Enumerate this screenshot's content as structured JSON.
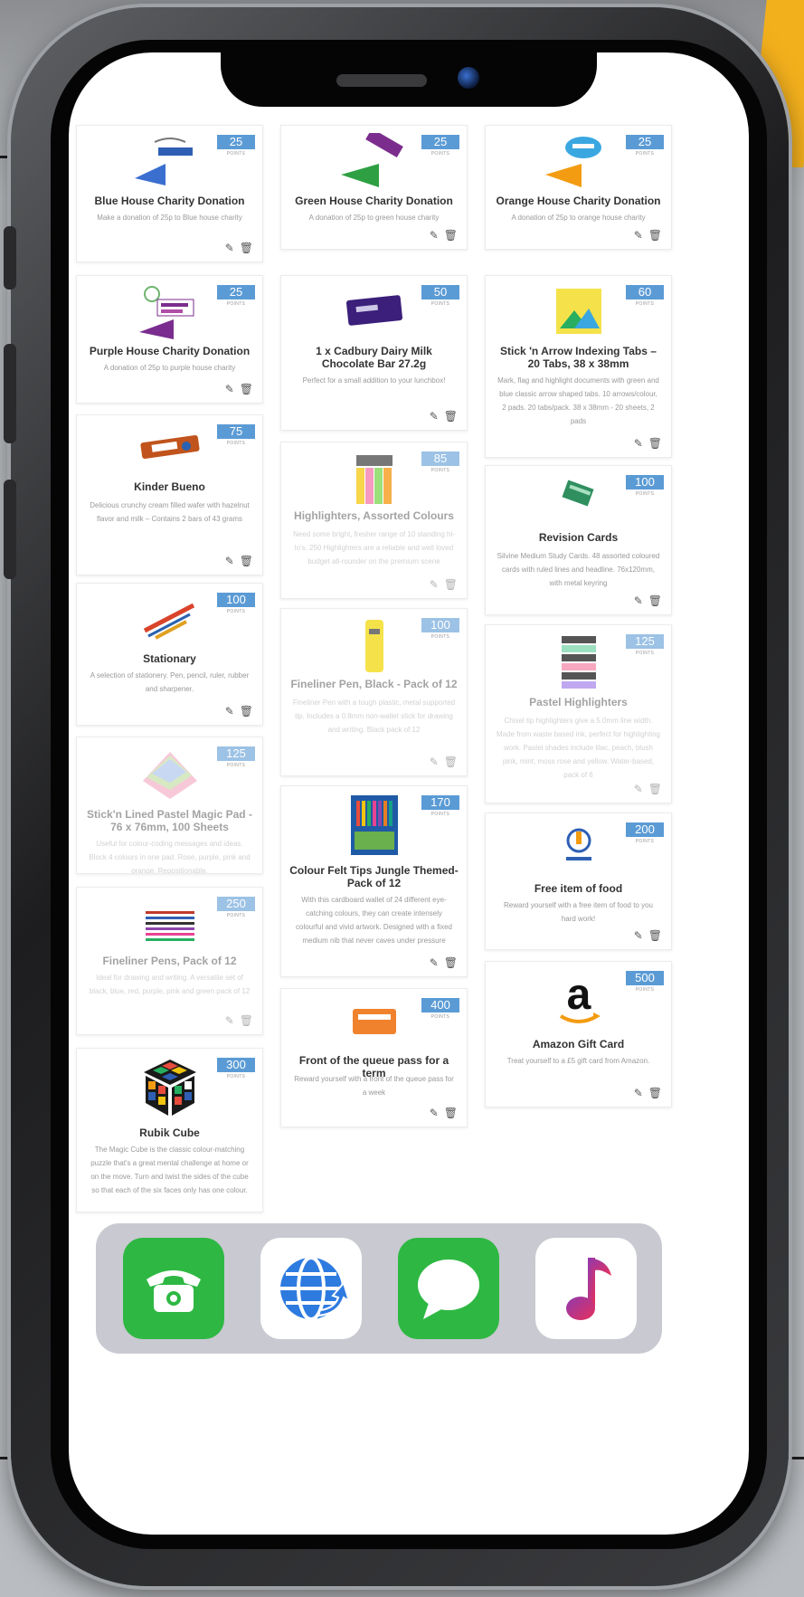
{
  "badge_label": "POINTS",
  "colors": {
    "accent": "#5b9bd5",
    "orange_corner": "#f3b01d",
    "phone_frame": "#1d1d1f"
  },
  "icons": {
    "edit": "pencil-icon",
    "delete": "trash-icon"
  },
  "rewards": [
    {
      "title": "Blue House Charity Donation",
      "desc": "Make a donation of 25p to Blue house charity",
      "points": "25"
    },
    {
      "title": "Green House Charity Donation",
      "desc": "A donation of 25p to green house charity",
      "points": "25"
    },
    {
      "title": "Orange House Charity Donation",
      "desc": "A donation of 25p to orange house charity",
      "points": "25"
    },
    {
      "title": "Purple House Charity Donation",
      "desc": "A donation of 25p to purple house charity",
      "points": "25"
    },
    {
      "title": "1 x Cadbury Dairy Milk Chocolate Bar 27.2g",
      "desc": "Perfect for a small addition to your lunchbox!",
      "points": "50"
    },
    {
      "title": "Stick 'n Arrow Indexing Tabs – 20 Tabs, 38 x 38mm",
      "desc": "Mark, flag and highlight documents with green and blue classic arrow shaped tabs. 10 arrows/colour, 2 pads. 20 tabs/pack. 38 x 38mm - 20 sheets, 2 pads",
      "points": "60"
    },
    {
      "title": "Kinder Bueno",
      "desc": "Delicious crunchy cream filled wafer with hazelnut flavor and milk – Contains 2 bars of 43 grams",
      "points": "75"
    },
    {
      "title": "Highlighters, Assorted Colours",
      "desc": "Need some bright, fresher range of 10 standing hi-lo's. 250 Highlighters are a reliable and well loved budget all-rounder on the premium scene",
      "points": "85"
    },
    {
      "title": "Revision Cards",
      "desc": "Silvine Medium Study Cards. 48 assorted coloured cards with ruled lines and headline. 76x120mm, with metal keyring",
      "points": "100"
    },
    {
      "title": "Stationary",
      "desc": "A selection of stationery. Pen, pencil, ruler, rubber and sharpener.",
      "points": "100"
    },
    {
      "title": "Fineliner Pen, Black - Pack of 12",
      "desc": "Fineliner Pen with a tough plastic, metal supported tip. Includes a 0.8mm non-wallet stick for drawing and writing. Black pack of 12",
      "points": "100"
    },
    {
      "title": "Pastel Highlighters",
      "desc": "Chisel tip highlighters give a 5.0mm line width. Made from waste based ink, perfect for highlighting work. Pastel shades include lilac, peach, blush pink, mint, moss rose and yellow. Water-based, pack of 6",
      "points": "125"
    },
    {
      "title": "Stick'n Lined Pastel Magic Pad - 76 x 76mm, 100 Sheets",
      "desc": "Useful for colour-coding messages and ideas. Block 4 colours in one pad. Rose, purple, pink and orange. Repositionable.",
      "points": "125"
    },
    {
      "title": "Colour Felt Tips Jungle Themed- Pack of 12",
      "desc": "With this cardboard wallet of 24 different eye-catching colours, they can create intensely colourful and vivid artwork. Designed with a fixed medium nib that never caves under pressure",
      "points": "170"
    },
    {
      "title": "Free item of food",
      "desc": "Reward yourself with a free item of food to you hard work!",
      "points": "200"
    },
    {
      "title": "Fineliner Pens, Pack of 12",
      "desc": "Ideal for drawing and writing. A versatile set of black, blue, red, purple, pink and green pack of 12",
      "points": "250"
    },
    {
      "title": "Front of the queue pass for a term",
      "desc": "Reward yourself with a front of the queue pass for a week",
      "points": "400"
    },
    {
      "title": "Amazon Gift Card",
      "desc": "Treat yourself to a £5 gift card from Amazon.",
      "points": "500"
    },
    {
      "title": "Rubik Cube",
      "desc": "The Magic Cube is the classic colour-matching puzzle that's a great mental challenge at home or on the move. Turn and twist the sides of the cube so that each of the six faces only has one colour.",
      "points": "300"
    }
  ],
  "dock": [
    {
      "name": "phone-app"
    },
    {
      "name": "browser-app"
    },
    {
      "name": "messages-app"
    },
    {
      "name": "music-app"
    }
  ]
}
